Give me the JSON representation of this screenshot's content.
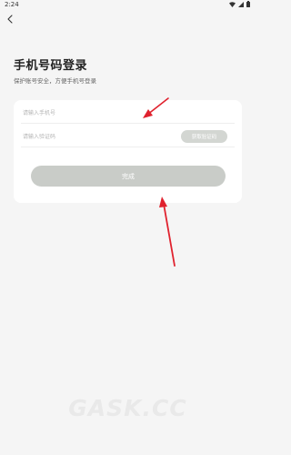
{
  "status_bar": {
    "time": "2:24",
    "icons": [
      "wifi-icon",
      "signal-icon",
      "battery-icon"
    ]
  },
  "nav": {
    "back_icon": "back-chevron-icon"
  },
  "header": {
    "title": "手机号码登录",
    "subtitle": "保护账号安全，方便手机号登录"
  },
  "form": {
    "phone_placeholder": "请输入手机号",
    "phone_value": "",
    "code_placeholder": "请输入验证码",
    "code_value": "",
    "get_code_label": "获取验证码",
    "submit_label": "完成"
  },
  "annotations": {
    "arrow_color": "#e0222e"
  },
  "watermark": {
    "text": "GASK.CC"
  },
  "colors": {
    "background": "#f5f5f5",
    "card": "#ffffff",
    "button_disabled": "#c9ccc8",
    "get_code_button": "#d3d6d2"
  }
}
